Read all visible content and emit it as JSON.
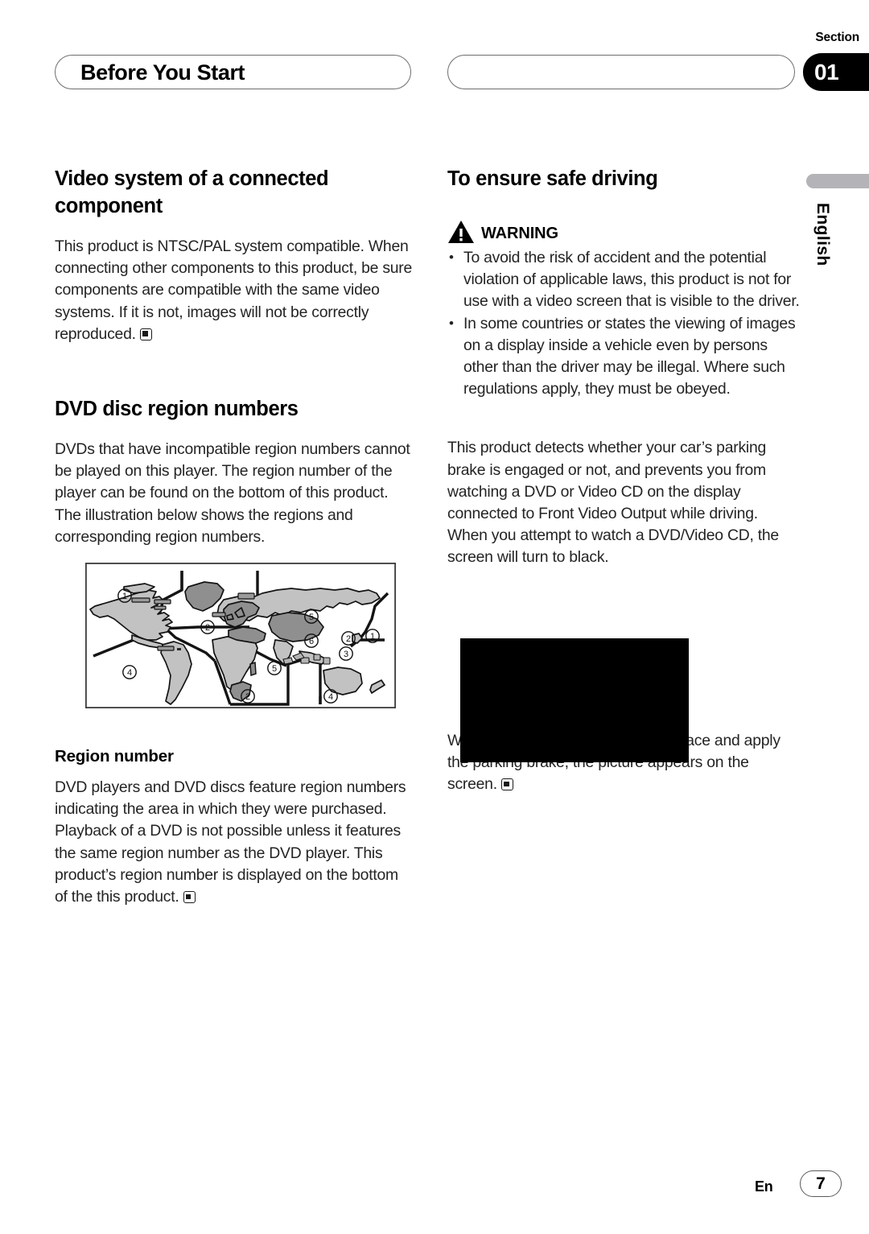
{
  "header": {
    "chapter_title": "Before You Start",
    "section_word": "Section",
    "section_number": "01"
  },
  "side_tab": {
    "language": "English"
  },
  "left_column": {
    "heading_1": "Video system of a connected component",
    "paragraph_1": "This product is NTSC/PAL system compatible. When connecting other components to this product, be sure components are compatible with the same video systems. If it is not, images will not be correctly reproduced.",
    "heading_2": "DVD disc region numbers",
    "paragraph_2": "DVDs that have incompatible region numbers cannot be played on this player. The region number of the player can be found on the bottom of this product.",
    "paragraph_3": "The illustration below shows the regions and corresponding region numbers.",
    "subheading_1": "Region number",
    "paragraph_4": "DVD players and DVD discs feature region numbers indicating the area in which they were purchased. Playback of a DVD is not possible unless it features the same region number as the DVD player. This product’s region number is displayed on the bottom of the this product."
  },
  "map_figure": {
    "region_labels": [
      "1",
      "2",
      "4",
      "5",
      "6",
      "3",
      "1",
      "2",
      "5",
      "2",
      "4"
    ],
    "colors": {
      "land_light": "#c2c2c2",
      "land_dark": "#8f8f8f",
      "outline": "#1a1a1a",
      "frame": "#3c3c3c"
    }
  },
  "right_column": {
    "heading_1": "To ensure safe driving",
    "warning_label": "WARNING",
    "warning_items": [
      "To avoid the risk of accident and the potential violation of applicable laws, this product is not for use with a video screen that is visible to the driver.",
      "In some countries or states the viewing of images on a display inside a vehicle even by persons other than the driver may be illegal. Where such regulations apply, they must be obeyed."
    ],
    "paragraph_1": "This product detects whether your car’s parking brake is engaged or not, and prevents you from watching a DVD or Video CD on the display connected to Front Video Output while driving. When you attempt to watch a DVD/Video CD, the screen will turn to black.",
    "paragraph_2": "When you park your car in a safe place and apply the parking brake, the picture appears on the screen."
  },
  "footer": {
    "language_code": "En",
    "page_number": "7"
  }
}
